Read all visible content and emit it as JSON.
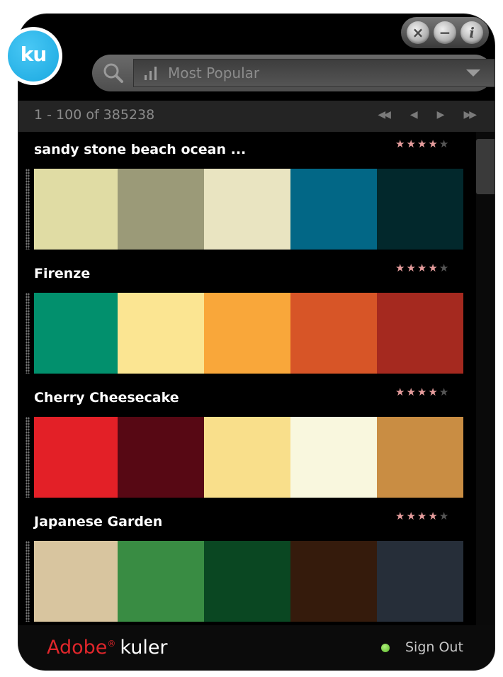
{
  "app": {
    "badge_text": "ku",
    "window_controls": [
      "close-icon",
      "minimize-icon",
      "info-icon"
    ]
  },
  "search": {
    "filter_icon": "bar-chart-icon",
    "value": "Most Popular"
  },
  "pager": {
    "count_text": "1 - 100 of 385238",
    "buttons": [
      "first-page",
      "previous-page",
      "next-page",
      "last-page"
    ]
  },
  "themes": [
    {
      "name": "sandy stone beach ocean ...",
      "rating": 4,
      "max_rating": 5,
      "colors": [
        "#E0DCA4",
        "#9B9A78",
        "#E9E4C1",
        "#026786",
        "#02282C"
      ]
    },
    {
      "name": "Firenze",
      "rating": 4,
      "max_rating": 5,
      "colors": [
        "#02906D",
        "#FBE592",
        "#F9A73A",
        "#D75527",
        "#A5291F"
      ]
    },
    {
      "name": "Cherry Cheesecake",
      "rating": 4,
      "max_rating": 5,
      "colors": [
        "#E32027",
        "#570814",
        "#F9DF8B",
        "#F9F7DE",
        "#C98D43"
      ]
    },
    {
      "name": "Japanese Garden",
      "rating": 4,
      "max_rating": 5,
      "colors": [
        "#D8C59F",
        "#398C43",
        "#0A4722",
        "#351B0C",
        "#262E39"
      ]
    }
  ],
  "footer": {
    "brand_adobe": "Adobe",
    "brand_reg": "®",
    "brand_kuler": "kuler",
    "status_color": "#6CC536",
    "signout_label": "Sign Out"
  }
}
